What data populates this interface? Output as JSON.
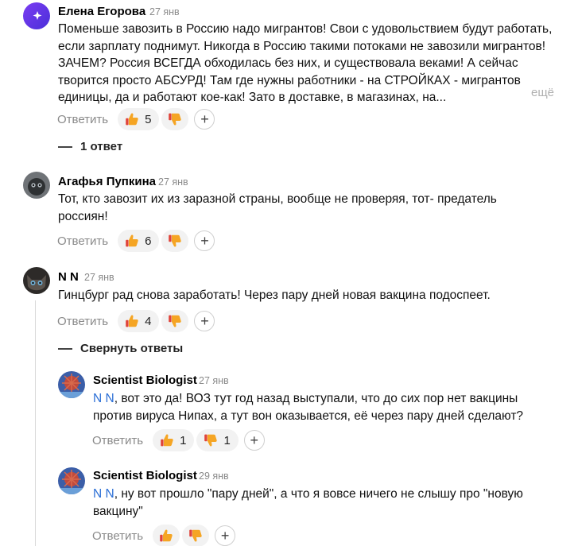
{
  "reply_label": "Ответить",
  "comments": [
    {
      "author": "Елена Егорова",
      "date": "27 янв",
      "text": "Поменьше завозить в Россию надо мигрантов! Свои с удовольствием будут работать, если зарплату поднимут. Никогда в Россию такими потоками не завозили мигрантов! ЗАЧЕМ? Россия ВСЕГДА обходилась без них, и существовала веками! А сейчас творится просто АБСУРД! Там где нужны работники - на СТРОЙКАХ - мигрантов единицы, да и работают кое-как! Зато в доставке, в магазинах, на...",
      "more_label": "ещё",
      "likes": "5",
      "dislikes": ""
    },
    {
      "author": "Агафья Пупкина",
      "date": "27 янв",
      "text": "Тот, кто завозит их из заразной страны, вообще не проверяя, тот- предатель россиян!",
      "likes": "6",
      "dislikes": ""
    },
    {
      "author": "N N",
      "date": "27 янв",
      "text": "Гинцбург рад снова заработать! Через пару дней новая вакцина подоспеет.",
      "likes": "4",
      "dislikes": ""
    }
  ],
  "thread_toggles": {
    "first": "1 ответ",
    "second": "Свернуть ответы"
  },
  "replies": [
    {
      "author": "Scientist Biologist",
      "date": "27 янв",
      "mention": "N N",
      "text": ", вот это да! ВОЗ тут год назад выступали, что до сих пор нет вакцины против вируса Нипах, а тут вон оказывается, её через пару дней сделают?",
      "likes": "1",
      "dislikes": "1"
    },
    {
      "author": "Scientist Biologist",
      "date": "29 янв",
      "mention": "N N",
      "text": ", ну вот прошло \"пару дней\", а что я вовсе ничего не слышу про \"новую вакцину\"",
      "likes": "",
      "dislikes": ""
    }
  ],
  "icons": {
    "like": "thumbs-up-icon",
    "dislike": "thumbs-down-icon",
    "add_reaction": "plus-icon"
  },
  "colors": {
    "mention": "#2b6fd6",
    "muted": "#8a8a8a",
    "reaction_bg": "#f2f2f2",
    "thumb": "#f5a524",
    "thumb_down_accent": "#e0443a"
  }
}
